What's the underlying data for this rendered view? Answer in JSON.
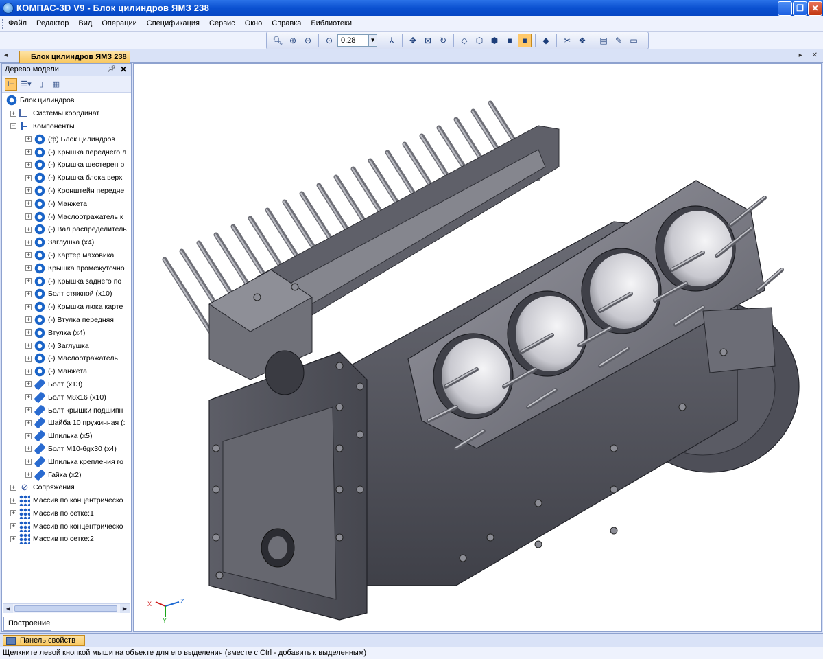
{
  "window": {
    "title": "КОМПАС-3D V9 - Блок цилиндров ЯМЗ 238",
    "minimize": "_",
    "maximize": "❐",
    "close": "✕"
  },
  "menu": [
    "Файл",
    "Редактор",
    "Вид",
    "Операции",
    "Спецификация",
    "Сервис",
    "Окно",
    "Справка",
    "Библиотеки"
  ],
  "toolbar": {
    "zoom_value": "0.28"
  },
  "tabs": {
    "document": "Блок цилиндров ЯМЗ 238"
  },
  "tree_panel": {
    "title": "Дерево модели",
    "root": "Блок цилиндров",
    "items": [
      {
        "label": "Системы координат",
        "icon": "coord"
      },
      {
        "label": "Компоненты",
        "icon": "comp"
      },
      {
        "label": "(ф) Блок цилиндров",
        "icon": "part"
      },
      {
        "label": "(-) Крышка переднего л",
        "icon": "part"
      },
      {
        "label": "(-) Крышка шестерен р",
        "icon": "part"
      },
      {
        "label": "(-) Крышка блока верх",
        "icon": "part"
      },
      {
        "label": "(-) Кронштейн передне",
        "icon": "part"
      },
      {
        "label": "(-) Манжета",
        "icon": "part"
      },
      {
        "label": "(-) Маслоотражатель к",
        "icon": "part"
      },
      {
        "label": "(-) Вал распределитель",
        "icon": "part"
      },
      {
        "label": "Заглушка (x4)",
        "icon": "part"
      },
      {
        "label": "(-) Картер маховика",
        "icon": "part"
      },
      {
        "label": "Крышка промежуточно",
        "icon": "part"
      },
      {
        "label": "(-) Крышка заднего по",
        "icon": "part"
      },
      {
        "label": "Болт стяжной (x10)",
        "icon": "part"
      },
      {
        "label": "(-) Крышка люка карте",
        "icon": "part"
      },
      {
        "label": "(-) Втулка передняя",
        "icon": "part"
      },
      {
        "label": "Втулка (x4)",
        "icon": "part"
      },
      {
        "label": "(-) Заглушка",
        "icon": "part"
      },
      {
        "label": "(-) Маслоотражатель",
        "icon": "part"
      },
      {
        "label": "(-) Манжета",
        "icon": "part"
      },
      {
        "label": "Болт (x13)",
        "icon": "std"
      },
      {
        "label": "Болт M8x16 (x10)",
        "icon": "std"
      },
      {
        "label": "Болт крышки подшипн",
        "icon": "std"
      },
      {
        "label": "Шайба 10 пружинная (:",
        "icon": "std"
      },
      {
        "label": "Шпилька (x5)",
        "icon": "std"
      },
      {
        "label": "Болт M10-6gx30 (x4)",
        "icon": "std"
      },
      {
        "label": "Шпилька крепления го",
        "icon": "std"
      },
      {
        "label": "Гайка (x2)",
        "icon": "std"
      },
      {
        "label": "Сопряжения",
        "icon": "clip"
      },
      {
        "label": "Массив по концентрическо",
        "icon": "array"
      },
      {
        "label": "Массив по сетке:1",
        "icon": "array"
      },
      {
        "label": "Массив по концентрическо",
        "icon": "array"
      },
      {
        "label": "Массив по сетке:2",
        "icon": "array"
      }
    ],
    "bottom_tab": "Построение"
  },
  "viewport": {
    "axes": {
      "x": "X",
      "y": "Y",
      "z": "Z"
    }
  },
  "property_panel": {
    "label": "Панель свойств"
  },
  "status": {
    "text": "Щелкните левой кнопкой мыши на объекте для его выделения (вместе с Ctrl - добавить к выделенным)"
  }
}
